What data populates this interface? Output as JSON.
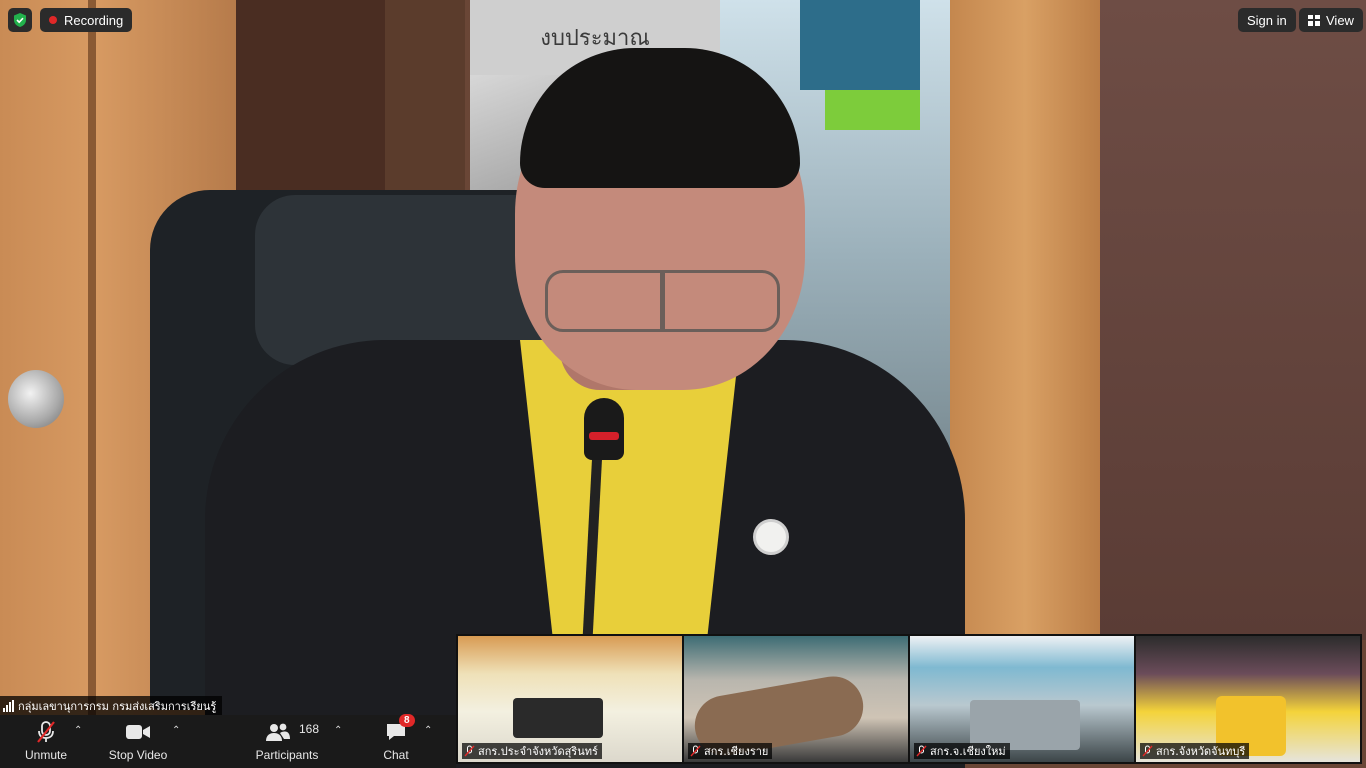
{
  "top_bar": {
    "security_icon": "shield-check-icon",
    "recording_label": "Recording",
    "sign_in_label": "Sign in",
    "view_label": "View"
  },
  "main_video": {
    "wall_sign": "งบประมาณ",
    "speaker_name": "กลุ่มเลขานุการกรม กรมส่งเสริมการเรียนรู้"
  },
  "toolbar": {
    "unmute_label": "Unmute",
    "stop_video_label": "Stop Video",
    "participants_label": "Participants",
    "participants_count": "168",
    "chat_label": "Chat",
    "chat_badge": "8"
  },
  "thumbnails": [
    {
      "name": "สกร.ประจำจังหวัดสุรินทร์"
    },
    {
      "name": "สกร.เชียงราย"
    },
    {
      "name": "สกร.จ.เชียงใหม่"
    },
    {
      "name": "สกร.จังหวัดจันทบุรี"
    }
  ],
  "colors": {
    "toolbar_bg": "#1a1a1a",
    "recording_dot": "#e02828",
    "security_green": "#22b14c",
    "badge_red": "#e02828"
  }
}
